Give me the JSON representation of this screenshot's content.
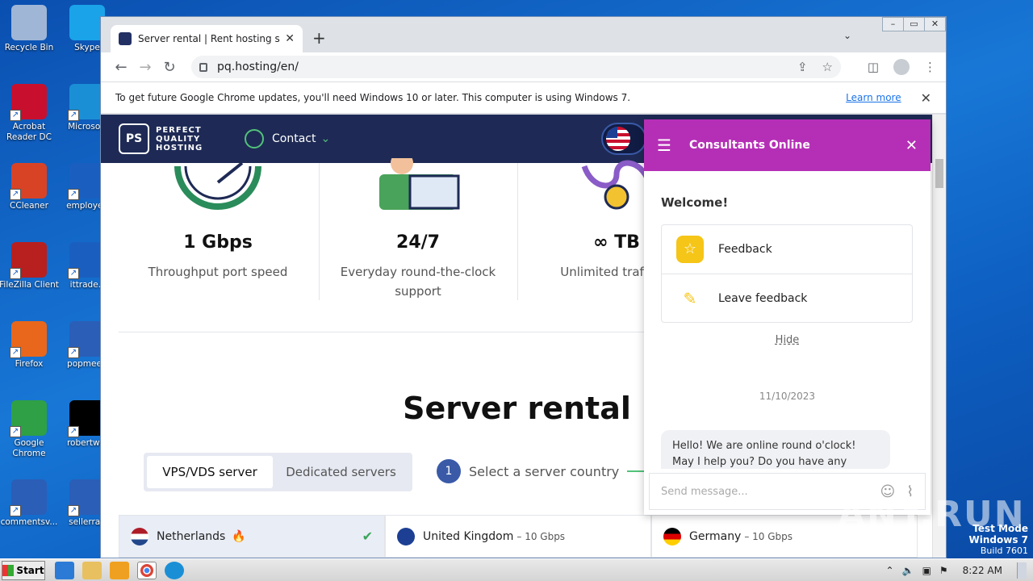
{
  "desktop": {
    "icons": [
      {
        "label": "Recycle Bin",
        "color": "#9fb6d6"
      },
      {
        "label": "Skype",
        "color": "#1aa3e8"
      },
      {
        "label": "Acrobat Reader DC",
        "color": "#c8102e"
      },
      {
        "label": "Microsoft",
        "color": "#1b8fd6"
      },
      {
        "label": "CCleaner",
        "color": "#d84326"
      },
      {
        "label": "employee",
        "color": "#1a5fc0"
      },
      {
        "label": "FileZilla Client",
        "color": "#b81f1f"
      },
      {
        "label": "ittrade.r",
        "color": "#1a5fc0"
      },
      {
        "label": "Firefox",
        "color": "#e8671c"
      },
      {
        "label": "popmeeti",
        "color": "#2b5eb7"
      },
      {
        "label": "Google Chrome",
        "color": "#2fa046"
      },
      {
        "label": "robertwel",
        "color": "#000000"
      },
      {
        "label": "commentsv...",
        "color": "#2b5eb7"
      },
      {
        "label": "sellerrap",
        "color": "#2b5eb7"
      }
    ]
  },
  "browser": {
    "tab_title": "Server rental | Rent hosting servers",
    "url": "pq.hosting/en/",
    "info_text": "To get future Google Chrome updates, you'll need Windows 10 or later. This computer is using Windows 7.",
    "learn_more": "Learn more"
  },
  "site": {
    "logo_mark": "PS",
    "logo_text": "PERFECT QUALITY HOSTING",
    "contact_label": "Contact",
    "stats": [
      {
        "value": "1 Gbps",
        "label": "Throughput port speed"
      },
      {
        "value": "24/7",
        "label": "Everyday round-the-clock support"
      },
      {
        "value": "∞ TB",
        "label": "Unlimited traffic in"
      }
    ],
    "heading": "Server rental",
    "switch": {
      "active": "VPS/VDS server",
      "inactive": "Dedicated servers"
    },
    "step": {
      "num": "1",
      "label": "Select a server country"
    },
    "countries": [
      {
        "name": "Netherlands",
        "speed": "",
        "flag": "linear-gradient(#ae1c28 33%,#fff 33% 66%,#21468b 66%)"
      },
      {
        "name": "United Kingdom",
        "speed": "– 10 Gbps",
        "flag": "#1c3f94"
      },
      {
        "name": "Germany",
        "speed": "– 10 Gbps",
        "flag": "linear-gradient(#000 33%,#dd0000 33% 66%,#ffce00 66%)"
      }
    ]
  },
  "chat": {
    "title": "Consultants Online",
    "welcome": "Welcome!",
    "feedback": "Feedback",
    "leave_feedback": "Leave feedback",
    "hide": "Hide",
    "date": "11/10/2023",
    "message": "Hello! We are online round o'clock! May I help you? Do you have any",
    "input_placeholder": "Send message..."
  },
  "overlay": {
    "watermark": "ANY.RUN",
    "test_mode": "Test Mode",
    "os": "Windows 7",
    "build": "Build 7601"
  },
  "taskbar": {
    "start": "Start",
    "time": "8:22 AM"
  }
}
